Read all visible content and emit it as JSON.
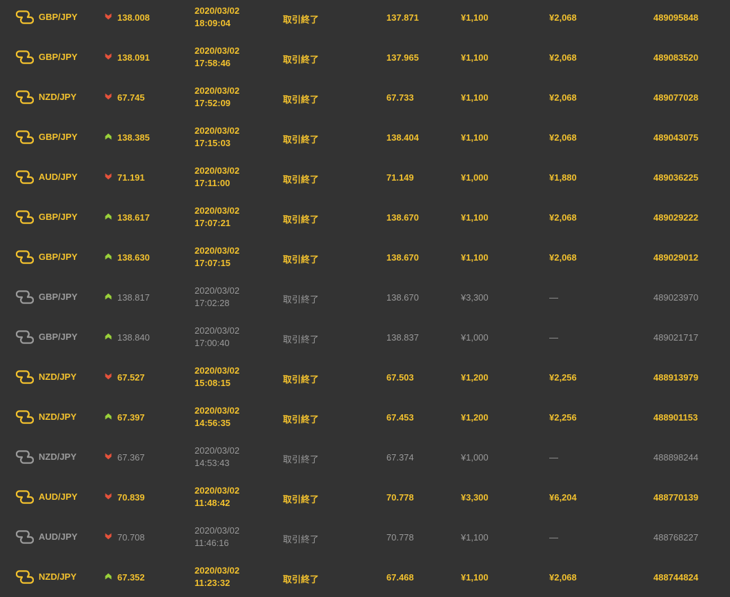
{
  "colors": {
    "background": "#333333",
    "win_text": "#f2c12e",
    "loss_text": "#9a9a9a",
    "down_arrow": "#e4523b",
    "up_arrow": "#9ad13a"
  },
  "trades": [
    {
      "outcome": "win",
      "asset_icon": "exchange-icon",
      "pair": "GBP/JPY",
      "direction": "down",
      "open_rate": "138.008",
      "date": "2020/03/02",
      "time": "18:09:04",
      "status": "取引終了",
      "close_rate": "137.871",
      "amount": "¥1,100",
      "payout": "¥2,068",
      "trade_id": "489095848"
    },
    {
      "outcome": "win",
      "asset_icon": "exchange-icon",
      "pair": "GBP/JPY",
      "direction": "down",
      "open_rate": "138.091",
      "date": "2020/03/02",
      "time": "17:58:46",
      "status": "取引終了",
      "close_rate": "137.965",
      "amount": "¥1,100",
      "payout": "¥2,068",
      "trade_id": "489083520"
    },
    {
      "outcome": "win",
      "asset_icon": "exchange-icon",
      "pair": "NZD/JPY",
      "direction": "down",
      "open_rate": "67.745",
      "date": "2020/03/02",
      "time": "17:52:09",
      "status": "取引終了",
      "close_rate": "67.733",
      "amount": "¥1,100",
      "payout": "¥2,068",
      "trade_id": "489077028"
    },
    {
      "outcome": "win",
      "asset_icon": "exchange-icon",
      "pair": "GBP/JPY",
      "direction": "up",
      "open_rate": "138.385",
      "date": "2020/03/02",
      "time": "17:15:03",
      "status": "取引終了",
      "close_rate": "138.404",
      "amount": "¥1,100",
      "payout": "¥2,068",
      "trade_id": "489043075"
    },
    {
      "outcome": "win",
      "asset_icon": "exchange-icon",
      "pair": "AUD/JPY",
      "direction": "down",
      "open_rate": "71.191",
      "date": "2020/03/02",
      "time": "17:11:00",
      "status": "取引終了",
      "close_rate": "71.149",
      "amount": "¥1,000",
      "payout": "¥1,880",
      "trade_id": "489036225"
    },
    {
      "outcome": "win",
      "asset_icon": "exchange-icon",
      "pair": "GBP/JPY",
      "direction": "up",
      "open_rate": "138.617",
      "date": "2020/03/02",
      "time": "17:07:21",
      "status": "取引終了",
      "close_rate": "138.670",
      "amount": "¥1,100",
      "payout": "¥2,068",
      "trade_id": "489029222"
    },
    {
      "outcome": "win",
      "asset_icon": "exchange-icon",
      "pair": "GBP/JPY",
      "direction": "up",
      "open_rate": "138.630",
      "date": "2020/03/02",
      "time": "17:07:15",
      "status": "取引終了",
      "close_rate": "138.670",
      "amount": "¥1,100",
      "payout": "¥2,068",
      "trade_id": "489029012"
    },
    {
      "outcome": "loss",
      "asset_icon": "exchange-icon",
      "pair": "GBP/JPY",
      "direction": "up",
      "open_rate": "138.817",
      "date": "2020/03/02",
      "time": "17:02:28",
      "status": "取引終了",
      "close_rate": "138.670",
      "amount": "¥3,300",
      "payout": "—",
      "trade_id": "489023970"
    },
    {
      "outcome": "loss",
      "asset_icon": "exchange-icon",
      "pair": "GBP/JPY",
      "direction": "up",
      "open_rate": "138.840",
      "date": "2020/03/02",
      "time": "17:00:40",
      "status": "取引終了",
      "close_rate": "138.837",
      "amount": "¥1,000",
      "payout": "—",
      "trade_id": "489021717"
    },
    {
      "outcome": "win",
      "asset_icon": "exchange-icon",
      "pair": "NZD/JPY",
      "direction": "down",
      "open_rate": "67.527",
      "date": "2020/03/02",
      "time": "15:08:15",
      "status": "取引終了",
      "close_rate": "67.503",
      "amount": "¥1,200",
      "payout": "¥2,256",
      "trade_id": "488913979"
    },
    {
      "outcome": "win",
      "asset_icon": "exchange-icon",
      "pair": "NZD/JPY",
      "direction": "up",
      "open_rate": "67.397",
      "date": "2020/03/02",
      "time": "14:56:35",
      "status": "取引終了",
      "close_rate": "67.453",
      "amount": "¥1,200",
      "payout": "¥2,256",
      "trade_id": "488901153"
    },
    {
      "outcome": "loss",
      "asset_icon": "exchange-icon",
      "pair": "NZD/JPY",
      "direction": "down",
      "open_rate": "67.367",
      "date": "2020/03/02",
      "time": "14:53:43",
      "status": "取引終了",
      "close_rate": "67.374",
      "amount": "¥1,000",
      "payout": "—",
      "trade_id": "488898244"
    },
    {
      "outcome": "win",
      "asset_icon": "exchange-icon",
      "pair": "AUD/JPY",
      "direction": "down",
      "open_rate": "70.839",
      "date": "2020/03/02",
      "time": "11:48:42",
      "status": "取引終了",
      "close_rate": "70.778",
      "amount": "¥3,300",
      "payout": "¥6,204",
      "trade_id": "488770139"
    },
    {
      "outcome": "loss",
      "asset_icon": "exchange-icon",
      "pair": "AUD/JPY",
      "direction": "down",
      "open_rate": "70.708",
      "date": "2020/03/02",
      "time": "11:46:16",
      "status": "取引終了",
      "close_rate": "70.778",
      "amount": "¥1,100",
      "payout": "—",
      "trade_id": "488768227"
    },
    {
      "outcome": "win",
      "asset_icon": "exchange-icon",
      "pair": "NZD/JPY",
      "direction": "up",
      "open_rate": "67.352",
      "date": "2020/03/02",
      "time": "11:23:32",
      "status": "取引終了",
      "close_rate": "67.468",
      "amount": "¥1,100",
      "payout": "¥2,068",
      "trade_id": "488744824"
    }
  ]
}
